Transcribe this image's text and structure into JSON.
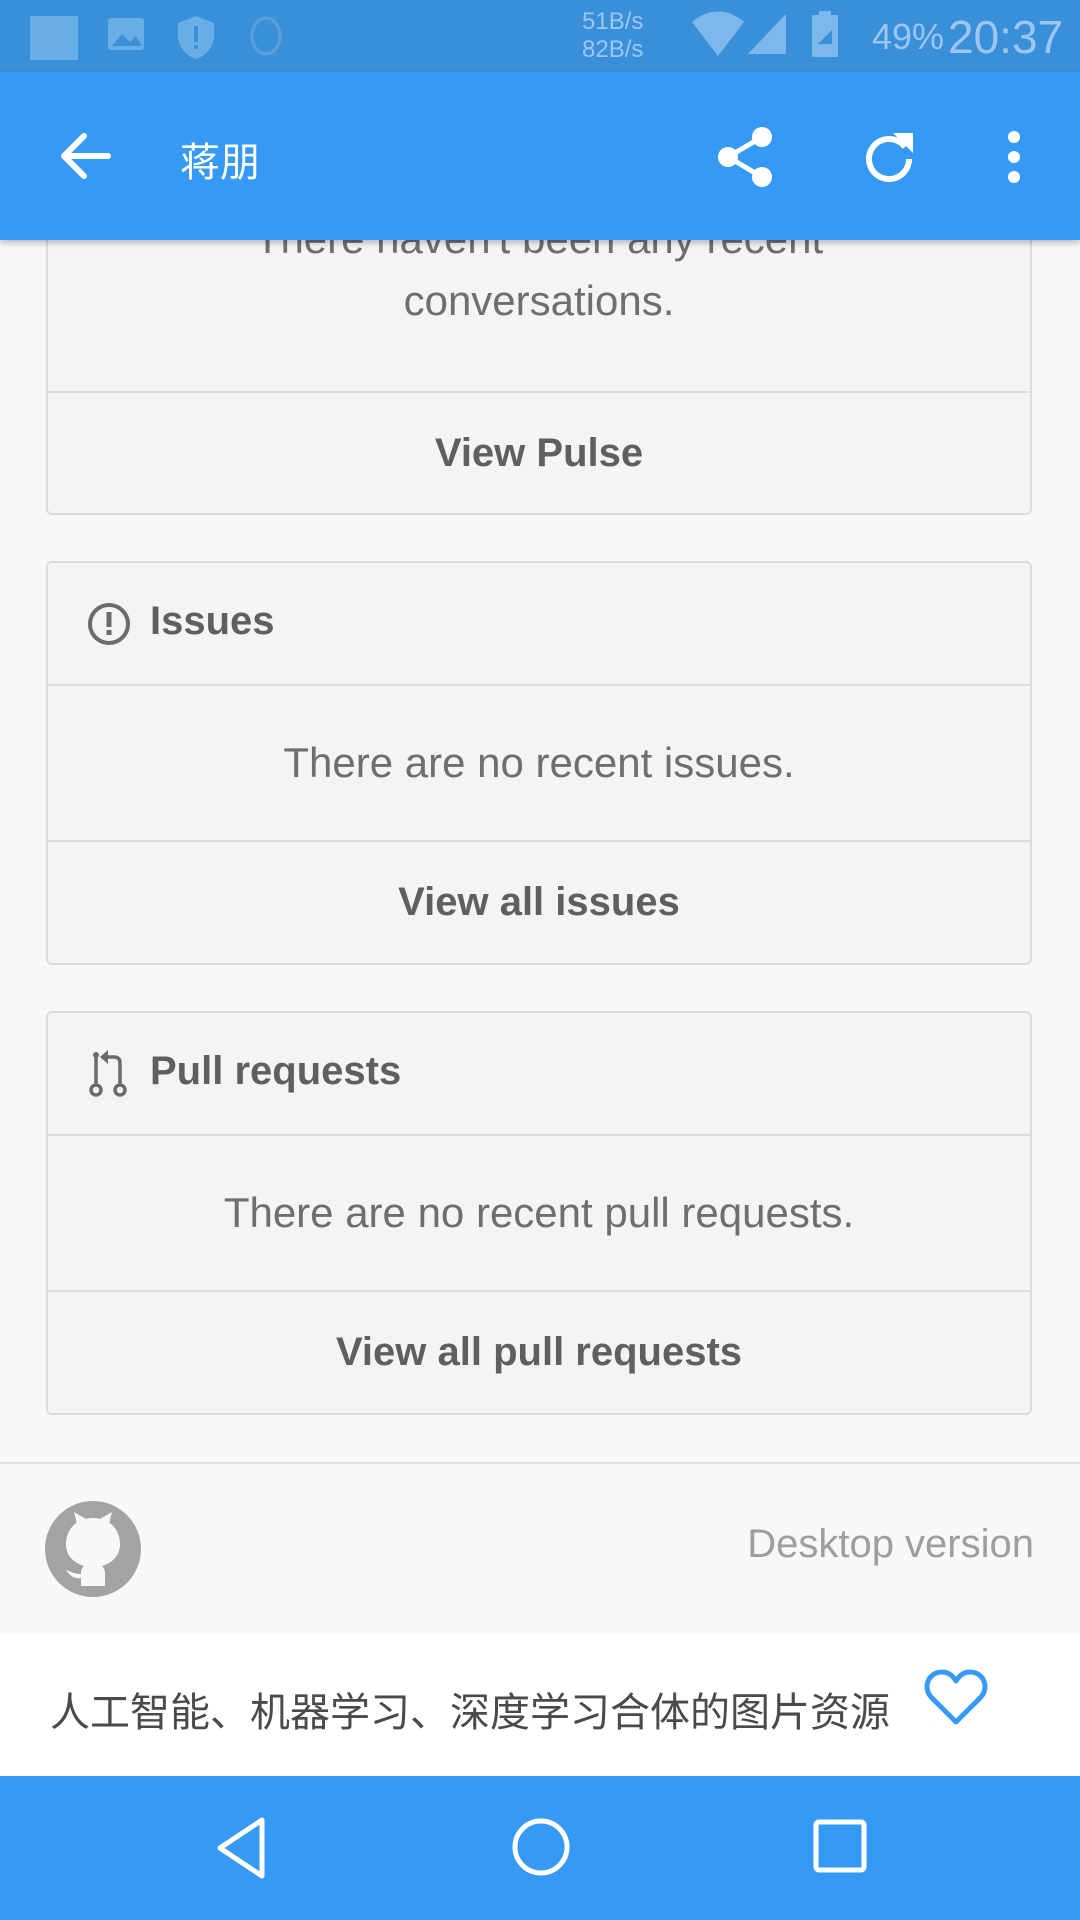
{
  "status_bar": {
    "speed_up": "51B/s",
    "speed_down": "82B/s",
    "battery_percent": "49%",
    "time": "20:37"
  },
  "app_bar": {
    "title": "蒋朋"
  },
  "pulse_card": {
    "message": "There haven't been any recent conversations.",
    "footer_link": "View Pulse"
  },
  "issues_card": {
    "title": "Issues",
    "message": "There are no recent issues.",
    "footer_link": "View all issues"
  },
  "pull_requests_card": {
    "title": "Pull requests",
    "message": "There are no recent pull requests.",
    "footer_link": "View all pull requests"
  },
  "site_footer": {
    "desktop_version_link": "Desktop version"
  },
  "favorite_bar": {
    "text": "人工智能、机器学习、深度学习合体的图片资源"
  },
  "colors": {
    "accent": "#369af4",
    "card_bg": "#f4f4f4",
    "text_gray": "#6e6e6e"
  }
}
